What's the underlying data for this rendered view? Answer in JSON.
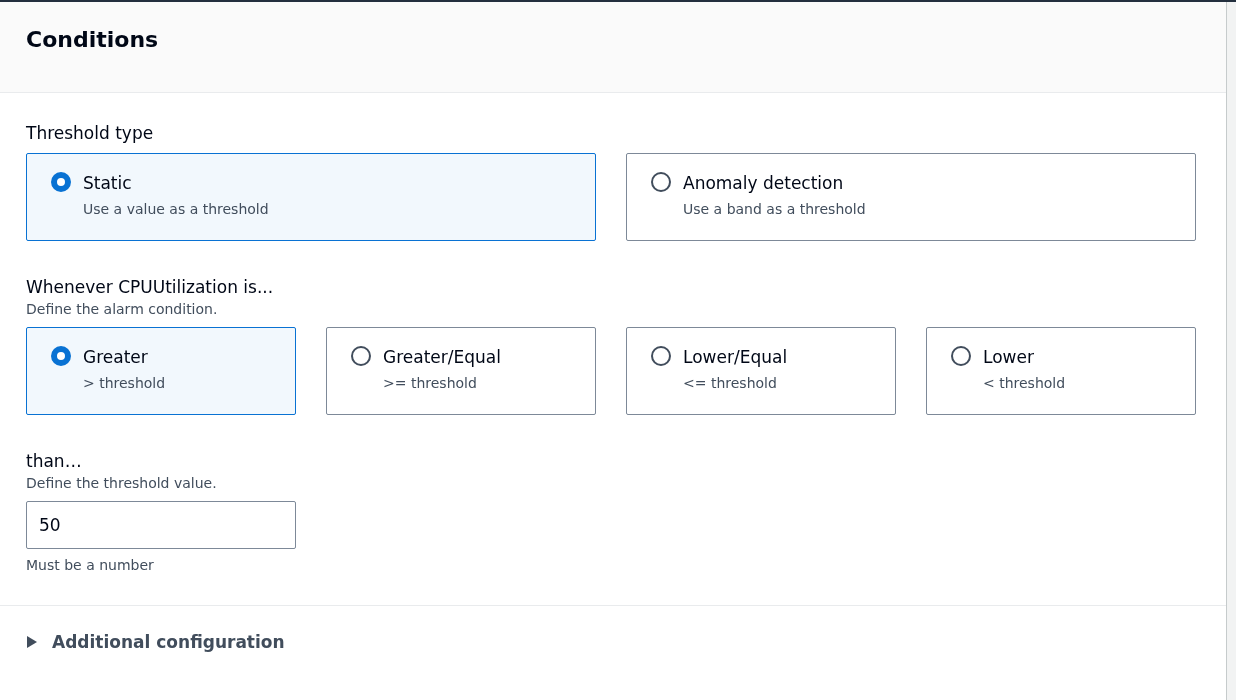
{
  "panel": {
    "title": "Conditions"
  },
  "threshold_type": {
    "label": "Threshold type",
    "options": [
      {
        "label": "Static",
        "description": "Use a value as a threshold",
        "selected": true
      },
      {
        "label": "Anomaly detection",
        "description": "Use a band as a threshold",
        "selected": false
      }
    ]
  },
  "condition": {
    "label": "Whenever CPUUtilization is...",
    "description": "Define the alarm condition.",
    "options": [
      {
        "label": "Greater",
        "description": "> threshold",
        "selected": true
      },
      {
        "label": "Greater/Equal",
        "description": ">= threshold",
        "selected": false
      },
      {
        "label": "Lower/Equal",
        "description": "<= threshold",
        "selected": false
      },
      {
        "label": "Lower",
        "description": "< threshold",
        "selected": false
      }
    ]
  },
  "threshold_value": {
    "label": "than…",
    "description": "Define the threshold value.",
    "value": "50",
    "hint": "Must be a number"
  },
  "additional_configuration": {
    "label": "Additional configuration",
    "expanded": false
  }
}
